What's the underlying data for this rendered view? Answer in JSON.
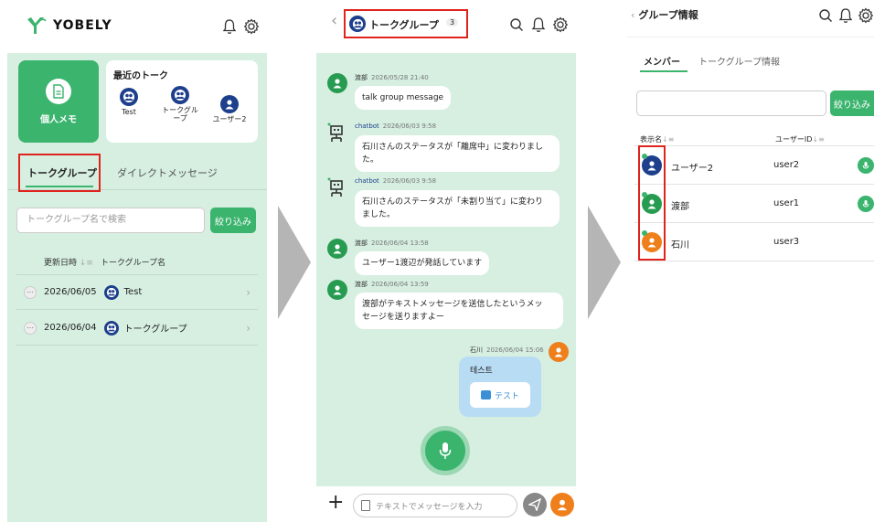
{
  "colors": {
    "accent": "#3bb46e",
    "panel_bg": "#d6efe1",
    "highlight": "#e0231c",
    "avatar_blue": "#1d3f8c",
    "avatar_orange": "#ee7f1b",
    "avatar_green": "#279c51"
  },
  "panel1": {
    "logo_text": "YOBELY",
    "memo_label": "個人メモ",
    "recent_title": "最近のトーク",
    "recent_items": [
      {
        "label": "Test"
      },
      {
        "label": "トークグル\nープ"
      },
      {
        "label": "ユーザー2"
      }
    ],
    "tabs": {
      "group": "トークグループ",
      "direct": "ダイレクトメッセージ"
    },
    "search_placeholder": "トークグループ名で検索",
    "filter_label": "絞り込み",
    "list_headers": {
      "updated": "更新日時",
      "name": "トークグループ名"
    },
    "rows": [
      {
        "date": "2026/06/05",
        "name": "Test"
      },
      {
        "date": "2026/06/04",
        "name": "トークグループ"
      }
    ]
  },
  "panel2": {
    "title": "トークグループ",
    "member_count": "3",
    "messages": [
      {
        "sender": "渡部",
        "time": "2026/05/28 21:40",
        "lines": [
          "talk group message"
        ]
      },
      {
        "sender": "chatbot",
        "time": "2026/06/03 9:58",
        "lines": [
          "石川さんのステータスが「離席中」に変わりまし",
          "た。"
        ]
      },
      {
        "sender": "chatbot",
        "time": "2026/06/03 9:58",
        "lines": [
          "石川さんのステータスが「未割り当て」に変わり",
          "ました。"
        ]
      },
      {
        "sender": "渡部",
        "time": "2026/06/04 13:58",
        "lines": [
          "ユーザー1渡辺が発話しています"
        ]
      },
      {
        "sender": "渡部",
        "time": "2026/06/04 13:59",
        "lines": [
          "渡部がテキストメッセージを送信したというメッ",
          "セージを送りますよー"
        ]
      }
    ],
    "own_message": {
      "sender": "石川",
      "time": "2026/06/04 15:06",
      "text": "테스트",
      "translation": "テスト"
    },
    "input_placeholder": "テキストでメッセージを入力",
    "plus": "+"
  },
  "panel3": {
    "title": "グループ情報",
    "tabs": {
      "members": "メンバー",
      "info": "トークグループ情報"
    },
    "filter_label": "絞り込み",
    "headers": {
      "display_name": "表示名",
      "user_id": "ユーザーID"
    },
    "members": [
      {
        "name": "ユーザー2",
        "user_id": "user2",
        "mic": true
      },
      {
        "name": "渡部",
        "user_id": "user1",
        "mic": true
      },
      {
        "name": "石川",
        "user_id": "user3",
        "mic": false
      }
    ]
  }
}
